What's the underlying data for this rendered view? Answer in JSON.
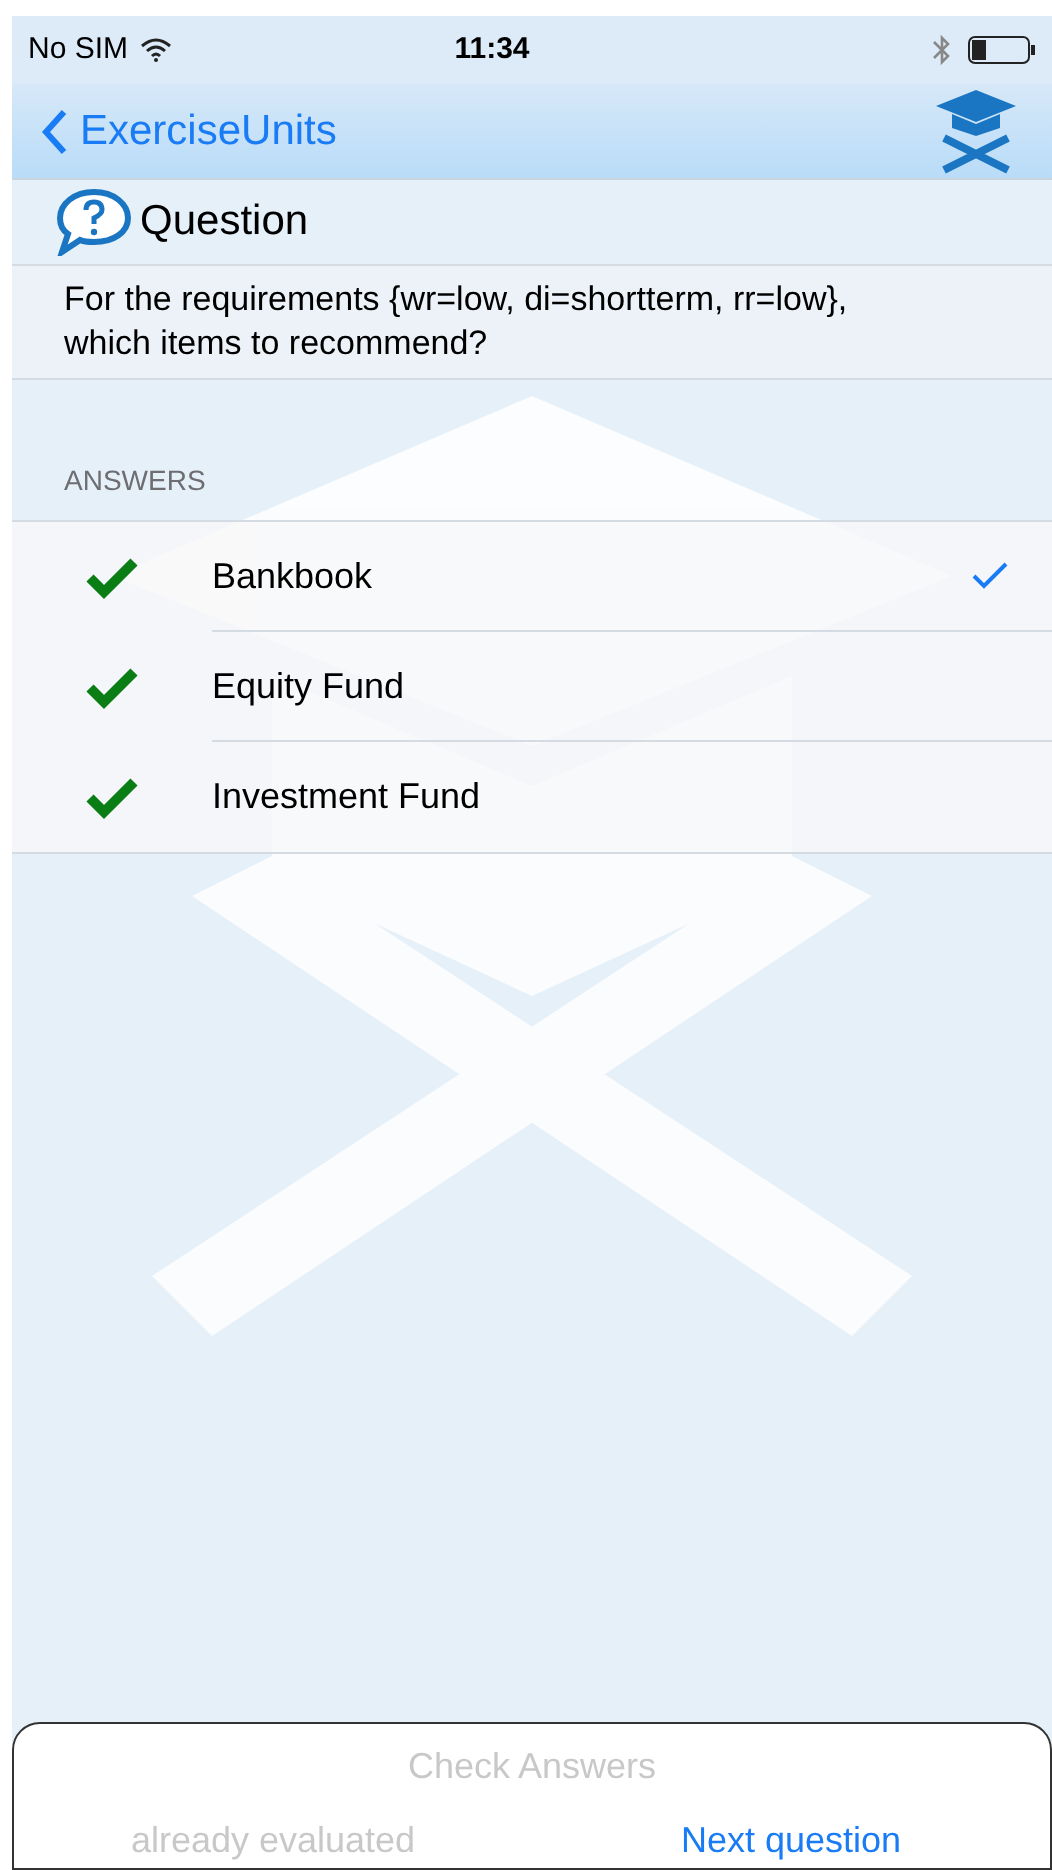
{
  "status_bar": {
    "carrier": "No SIM",
    "time": "11:34"
  },
  "nav": {
    "back_label": "ExerciseUnits"
  },
  "question": {
    "title": "Question",
    "text": "For the requirements {wr=low, di=shortterm, rr=low}, which items to recommend?"
  },
  "answers_header": "ANSWERS",
  "answers": [
    {
      "label": "Bankbook",
      "correct": true,
      "selected": true
    },
    {
      "label": "Equity Fund",
      "correct": true,
      "selected": false
    },
    {
      "label": "Investment Fund",
      "correct": true,
      "selected": false
    }
  ],
  "footer": {
    "check_button": {
      "label": "Check Answers",
      "disabled": true
    },
    "status_button": {
      "label": "already evaluated",
      "disabled": true
    },
    "next_button": {
      "label": "Next question",
      "disabled": false
    }
  }
}
